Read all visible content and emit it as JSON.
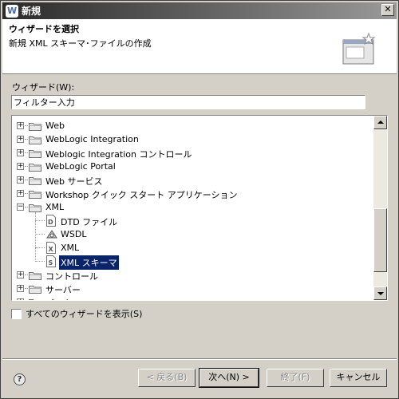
{
  "window": {
    "title": "新規"
  },
  "header": {
    "title": "ウィザードを選択",
    "description": "新規 XML スキーマ･ファイルの作成"
  },
  "wizard_label": "ウィザード(W):",
  "filter": {
    "value": "フィルター入力"
  },
  "tree": {
    "items": [
      {
        "label": "Web",
        "type": "folder",
        "expanded": false
      },
      {
        "label": "WebLogic Integration",
        "type": "folder",
        "expanded": false
      },
      {
        "label": "Weblogic Integration コントロール",
        "type": "folder",
        "expanded": false
      },
      {
        "label": "WebLogic Portal",
        "type": "folder",
        "expanded": false
      },
      {
        "label": "Web サービス",
        "type": "folder",
        "expanded": false
      },
      {
        "label": "Workshop クイック スタート アプリケーション",
        "type": "folder",
        "expanded": false
      },
      {
        "label": "XML",
        "type": "folder",
        "expanded": true
      },
      {
        "label": "DTD ファイル",
        "type": "file",
        "icon": "dtd-file-icon"
      },
      {
        "label": "WSDL",
        "type": "file",
        "icon": "wsdl-icon"
      },
      {
        "label": "XML",
        "type": "file",
        "icon": "xml-file-icon"
      },
      {
        "label": "XML スキーマ",
        "type": "file",
        "icon": "xml-schema-icon",
        "selected": true
      },
      {
        "label": "コントロール",
        "type": "folder",
        "expanded": false
      },
      {
        "label": "サーバー",
        "type": "folder",
        "expanded": false
      },
      {
        "label": "データ",
        "type": "folder",
        "expanded": false
      }
    ]
  },
  "show_all_label": "すべてのウィザードを表示(S)",
  "buttons": {
    "help": "?",
    "back": "< 戻る(B)",
    "next": "次へ(N) >",
    "finish": "終了(F)",
    "cancel": "キャンセル"
  },
  "colors": {
    "selection": "#0a246a",
    "dialog_bg": "#d4d0c8"
  }
}
